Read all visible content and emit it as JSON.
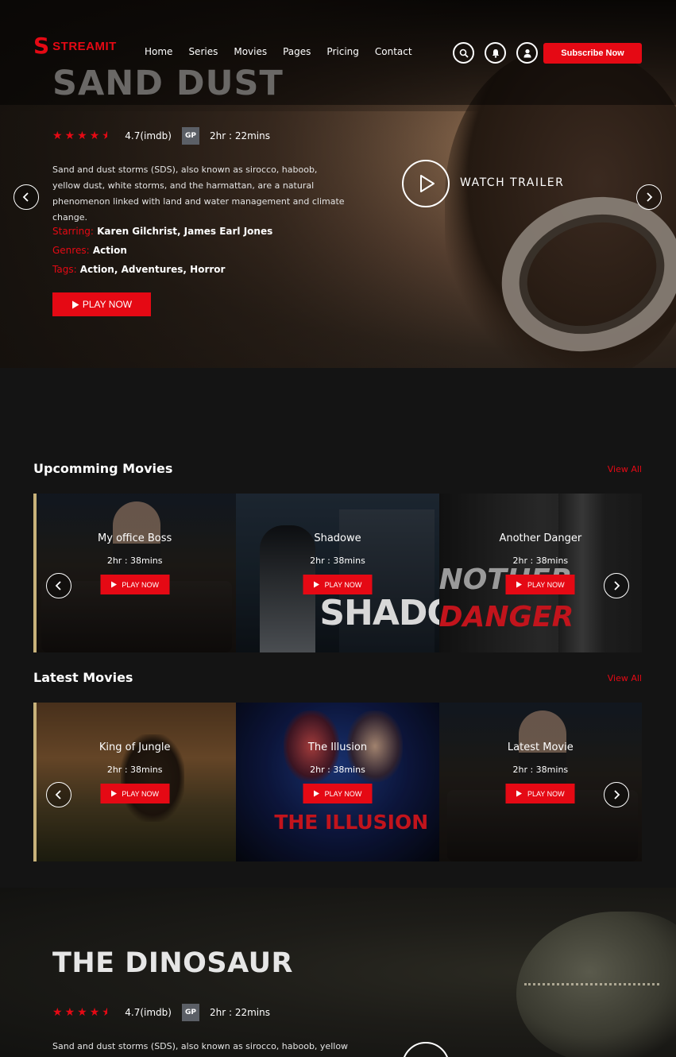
{
  "brand": {
    "logo_mark": "S",
    "name": "STREAMIT"
  },
  "nav": {
    "items": [
      "Home",
      "Series",
      "Movies",
      "Pages",
      "Pricing",
      "Contact"
    ]
  },
  "header": {
    "subscribe_label": "Subscribe Now",
    "icons": [
      "search-icon",
      "bell-icon",
      "user-icon"
    ]
  },
  "hero": {
    "title": "SAND DUST",
    "rating_stars": 4.5,
    "rating": "4.7(imdb)",
    "badge": "GP",
    "duration": "2hr : 22mins",
    "description": "Sand and dust storms (SDS), also known as sirocco, haboob, yellow dust, white storms, and the harmattan, are a natural phenomenon linked with land and water management and climate change.",
    "starring_key": "Starring:",
    "starring": "Karen Gilchrist, James Earl Jones",
    "genres_key": "Genres:",
    "genres": "Action",
    "tags_key": "Tags:",
    "tags": "Action, Adventures, Horror",
    "play_label": "PLAY NOW",
    "trailer_label": "WATCH TRAILER"
  },
  "upcoming": {
    "title": "Upcomming Movies",
    "view_all": "View All",
    "cards": [
      {
        "title": "My office Boss",
        "duration": "2hr : 38mins",
        "play": "PLAY NOW"
      },
      {
        "title": "Shadowe",
        "duration": "2hr : 38mins",
        "play": "PLAY NOW",
        "poster_text": "SHADO"
      },
      {
        "title": "Another Danger",
        "duration": "2hr : 38mins",
        "play": "PLAY NOW",
        "poster_text": "NOTHER",
        "poster_text2": "DANGER"
      }
    ]
  },
  "latest": {
    "title": "Latest Movies",
    "view_all": "View All",
    "cards": [
      {
        "title": "King of Jungle",
        "duration": "2hr : 38mins",
        "play": "PLAY NOW"
      },
      {
        "title": "The Illusion",
        "duration": "2hr : 38mins",
        "play": "PLAY NOW",
        "poster_text": "THE ILLUSION"
      },
      {
        "title": "Latest Movie",
        "duration": "2hr : 38mins",
        "play": "PLAY NOW"
      }
    ]
  },
  "hero2": {
    "title": "THE DINOSAUR",
    "rating_stars": 4.5,
    "rating": "4.7(imdb)",
    "badge": "GP",
    "duration": "2hr : 22mins",
    "description": "Sand and dust storms (SDS), also known as sirocco, haboob, yellow"
  },
  "colors": {
    "accent": "#e50914",
    "background": "#141414",
    "badge": "#5b5f66"
  }
}
